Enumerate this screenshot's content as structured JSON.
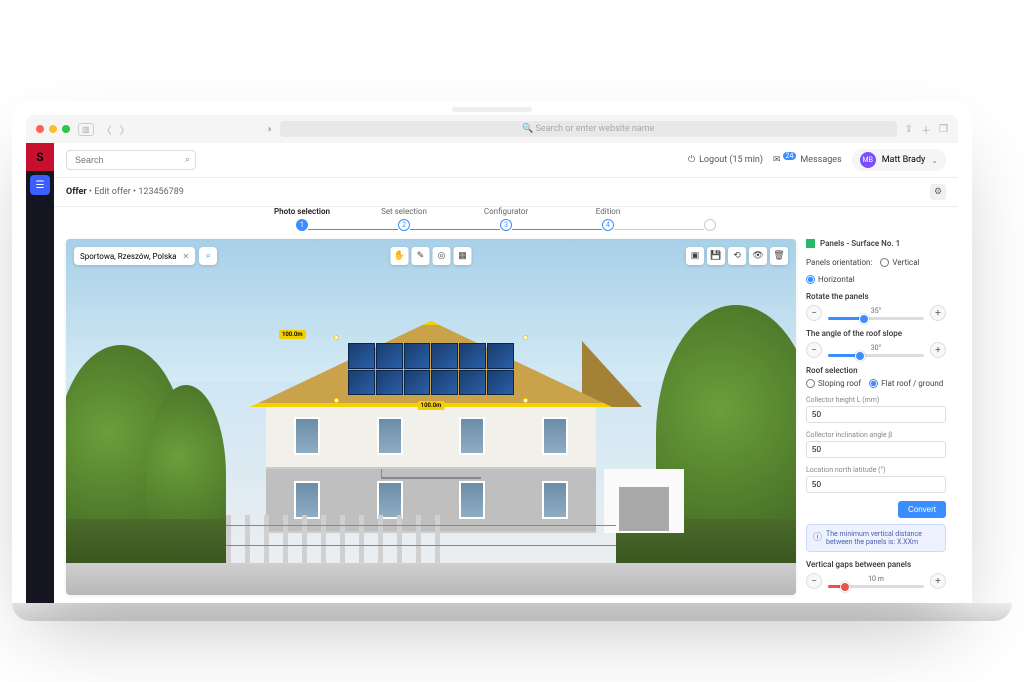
{
  "browser": {
    "url_placeholder": "Search or enter website name"
  },
  "topbar": {
    "search_placeholder": "Search",
    "logout_label": "Logout (15 min)",
    "messages_label": "Messages",
    "messages_count": "24",
    "user_initials": "MB",
    "user_name": "Matt Brady"
  },
  "breadcrumb": {
    "root": "Offer",
    "section": "Edit offer",
    "id": "123456789"
  },
  "stepper": {
    "items": [
      "Photo selection",
      "Set selection",
      "Configurator",
      "Edition",
      ""
    ]
  },
  "canvas": {
    "address": "Sportowa, Rzeszów, Polska",
    "dim_a": "100.0m",
    "dim_b": "100.0m"
  },
  "panel": {
    "title": "Panels - Surface No. 1",
    "orientation_label": "Panels orientation:",
    "orientation_vertical": "Vertical",
    "orientation_horizontal": "Horizontal",
    "rotate_label": "Rotate the panels",
    "rotate_value": "35°",
    "angle_label": "The angle of the roof slope",
    "angle_value": "30°",
    "roof_sel_label": "Roof selection",
    "roof_sloping": "Sloping roof",
    "roof_flat": "Flat roof / ground",
    "collector_h_label": "Collector height L (mm)",
    "collector_h_value": "50",
    "collector_incl_label": "Collector inclination angle β",
    "collector_incl_value": "50",
    "lat_label": "Location north latitude (°)",
    "lat_value": "50",
    "convert_btn": "Convert",
    "info_text": "The minimum vertical distance between the panels is: X.XXm",
    "vgap_label": "Vertical gaps between panels",
    "vgap_value": "10 m"
  }
}
